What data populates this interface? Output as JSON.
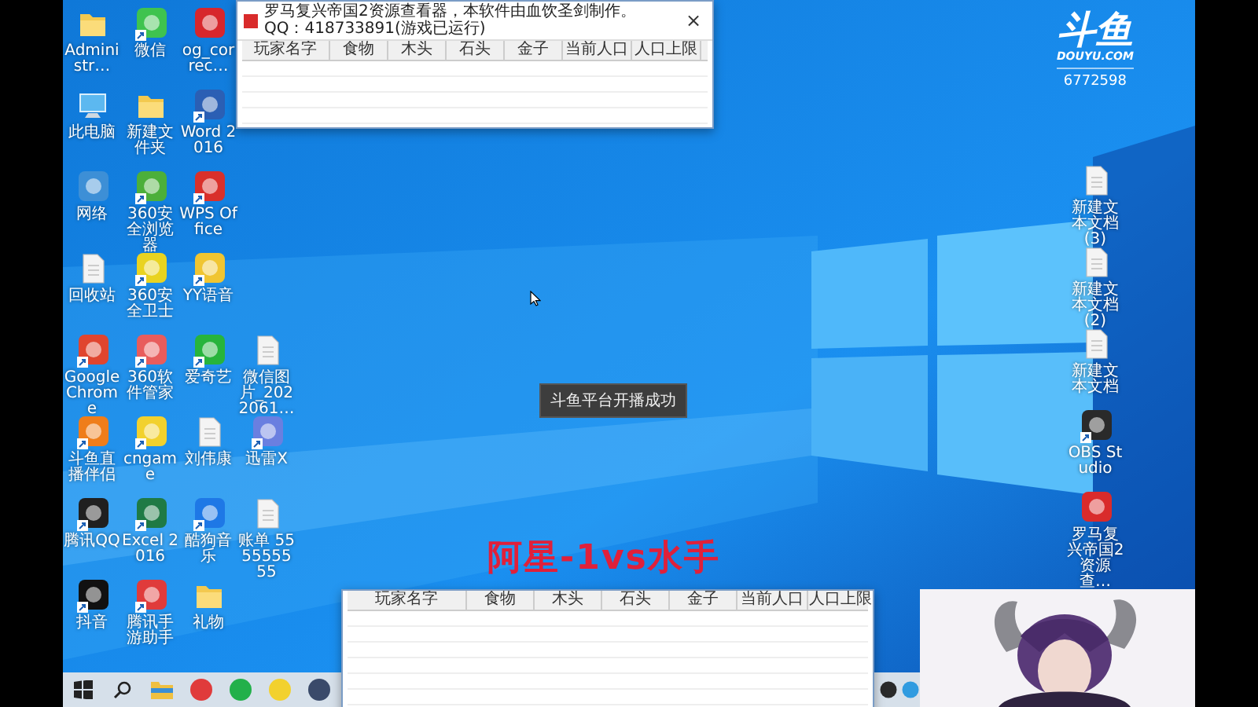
{
  "desktop_icons": {
    "columns": [
      [
        {
          "label": "Administr…",
          "kind": "folder",
          "shortcut": false
        },
        {
          "label": "此电脑",
          "kind": "computer",
          "shortcut": false
        },
        {
          "label": "网络",
          "kind": "app",
          "color": "#3d8fd6",
          "shortcut": false
        },
        {
          "label": "回收站",
          "kind": "file",
          "shortcut": false
        },
        {
          "label": "Google Chrome",
          "kind": "app",
          "color": "#e0452f",
          "shortcut": true
        },
        {
          "label": "斗鱼直播伴侣",
          "kind": "app",
          "color": "#ef7d1a",
          "shortcut": true
        },
        {
          "label": "腾讯QQ",
          "kind": "app",
          "color": "#202020",
          "shortcut": true
        },
        {
          "label": "抖音",
          "kind": "app",
          "color": "#111111",
          "shortcut": true
        }
      ],
      [
        {
          "label": "微信",
          "kind": "app",
          "color": "#3fc34f",
          "shortcut": true
        },
        {
          "label": "新建文件夹",
          "kind": "folder",
          "shortcut": false
        },
        {
          "label": "360安全浏览器",
          "kind": "app",
          "color": "#4caf3a",
          "shortcut": true
        },
        {
          "label": "360安全卫士",
          "kind": "app",
          "color": "#e9d320",
          "shortcut": true
        },
        {
          "label": "360软件管家",
          "kind": "app",
          "color": "#e85c5c",
          "shortcut": true
        },
        {
          "label": "cngame",
          "kind": "app",
          "color": "#f2d12e",
          "shortcut": true
        },
        {
          "label": "Excel 2016",
          "kind": "app",
          "color": "#1f7a45",
          "shortcut": true
        },
        {
          "label": "腾讯手游助手",
          "kind": "app",
          "color": "#e03b3b",
          "shortcut": true
        }
      ],
      [
        {
          "label": "og_correc…",
          "kind": "app",
          "color": "#d7262c",
          "shortcut": false
        },
        {
          "label": "Word 2016",
          "kind": "app",
          "color": "#2b5fb4",
          "shortcut": true
        },
        {
          "label": "WPS Office",
          "kind": "app",
          "color": "#d9302b",
          "shortcut": true
        },
        {
          "label": "YY语音",
          "kind": "app",
          "color": "#f0c531",
          "shortcut": true
        },
        {
          "label": "爱奇艺",
          "kind": "app",
          "color": "#27b43c",
          "shortcut": true
        },
        {
          "label": "刘伟康",
          "kind": "file",
          "shortcut": false
        },
        {
          "label": "酷狗音乐",
          "kind": "app",
          "color": "#1e78e6",
          "shortcut": true
        },
        {
          "label": "礼物",
          "kind": "folder",
          "shortcut": false
        }
      ],
      [
        {
          "label": "微信图片_2022061…",
          "kind": "file",
          "shortcut": false
        },
        {
          "label": "迅雷X",
          "kind": "app",
          "color": "#6a7fe0",
          "shortcut": true
        },
        {
          "label": "账单 555555555",
          "kind": "file",
          "shortcut": false
        }
      ]
    ]
  },
  "right_icons": [
    {
      "label": "新建文本文档 (3)",
      "kind": "file",
      "shortcut": false
    },
    {
      "label": "新建文本文档 (2)",
      "kind": "file",
      "shortcut": false
    },
    {
      "label": "新建文本文档",
      "kind": "file",
      "shortcut": false
    },
    {
      "label": "OBS Studio",
      "kind": "app",
      "color": "#2a2a2a",
      "shortcut": true
    },
    {
      "label": "罗马复兴帝国2资源查…",
      "kind": "app",
      "color": "#d92b2b",
      "shortcut": false
    }
  ],
  "resource_window": {
    "title": "罗马复兴帝国2资源查看器，本软件由血饮圣剑制作。QQ：418733891(游戏已运行)",
    "close": "×",
    "columns": [
      "玩家名字",
      "食物",
      "木头",
      "石头",
      "金子",
      "当前人口",
      "人口上限"
    ]
  },
  "resource_window_2": {
    "columns": [
      "玩家名字",
      "食物",
      "木头",
      "石头",
      "金子",
      "当前人口",
      "人口上限"
    ]
  },
  "toast": "斗鱼平台开播成功",
  "overlay_title": "阿星-1vs水手",
  "stream_logo": {
    "name": "斗鱼",
    "site": "DOUYU.COM",
    "room": "6772598"
  },
  "taskbar": {
    "icons": [
      {
        "kind": "start"
      },
      {
        "kind": "search"
      },
      {
        "kind": "folder"
      },
      {
        "kind": "app",
        "color": "#e03b3b"
      },
      {
        "kind": "app",
        "color": "#22b04a"
      },
      {
        "kind": "app",
        "color": "#f2d12e"
      },
      {
        "kind": "app",
        "color": "#3a4a6a"
      }
    ],
    "tray": [
      {
        "kind": "app",
        "color": "#2a2a2a"
      },
      {
        "kind": "app",
        "color": "#2f9be0"
      }
    ]
  }
}
